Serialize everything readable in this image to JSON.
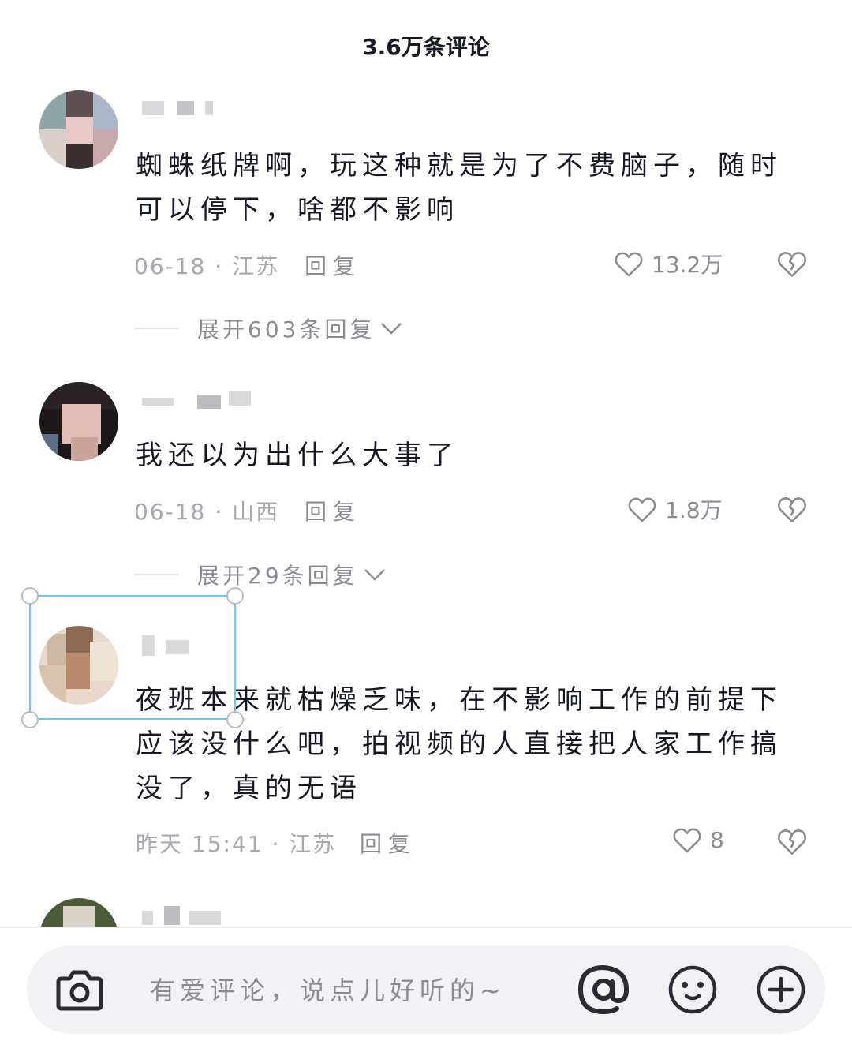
{
  "header": {
    "title": "3.6万条评论"
  },
  "comments": [
    {
      "text": "蜘蛛纸牌啊，玩这种就是为了不费脑子，随时可以停下，啥都不影响",
      "meta": "06-18 · 江苏",
      "reply_label": "回复",
      "likes": "13.2万",
      "expand_label": "展开603条回复"
    },
    {
      "text": "我还以为出什么大事了",
      "meta": "06-18 · 山西",
      "reply_label": "回复",
      "likes": "1.8万",
      "expand_label": "展开29条回复"
    },
    {
      "text": "夜班本来就枯燥乏味，在不影响工作的前提下应该没什么吧，拍视频的人直接把人家工作搞没了，真的无语",
      "meta": "昨天 15:41 · 江苏",
      "reply_label": "回复",
      "likes": "8"
    }
  ],
  "input_bar": {
    "placeholder": "有爱评论，说点儿好听的~",
    "icons": [
      "camera-icon",
      "at-icon",
      "emoji-icon",
      "add-icon"
    ]
  },
  "colors": {
    "text": "#161823",
    "meta": "#a7a8ad",
    "secondary": "#8a8b91",
    "input_bg": "#f2f2f4",
    "selection": "#6ec6f5"
  }
}
